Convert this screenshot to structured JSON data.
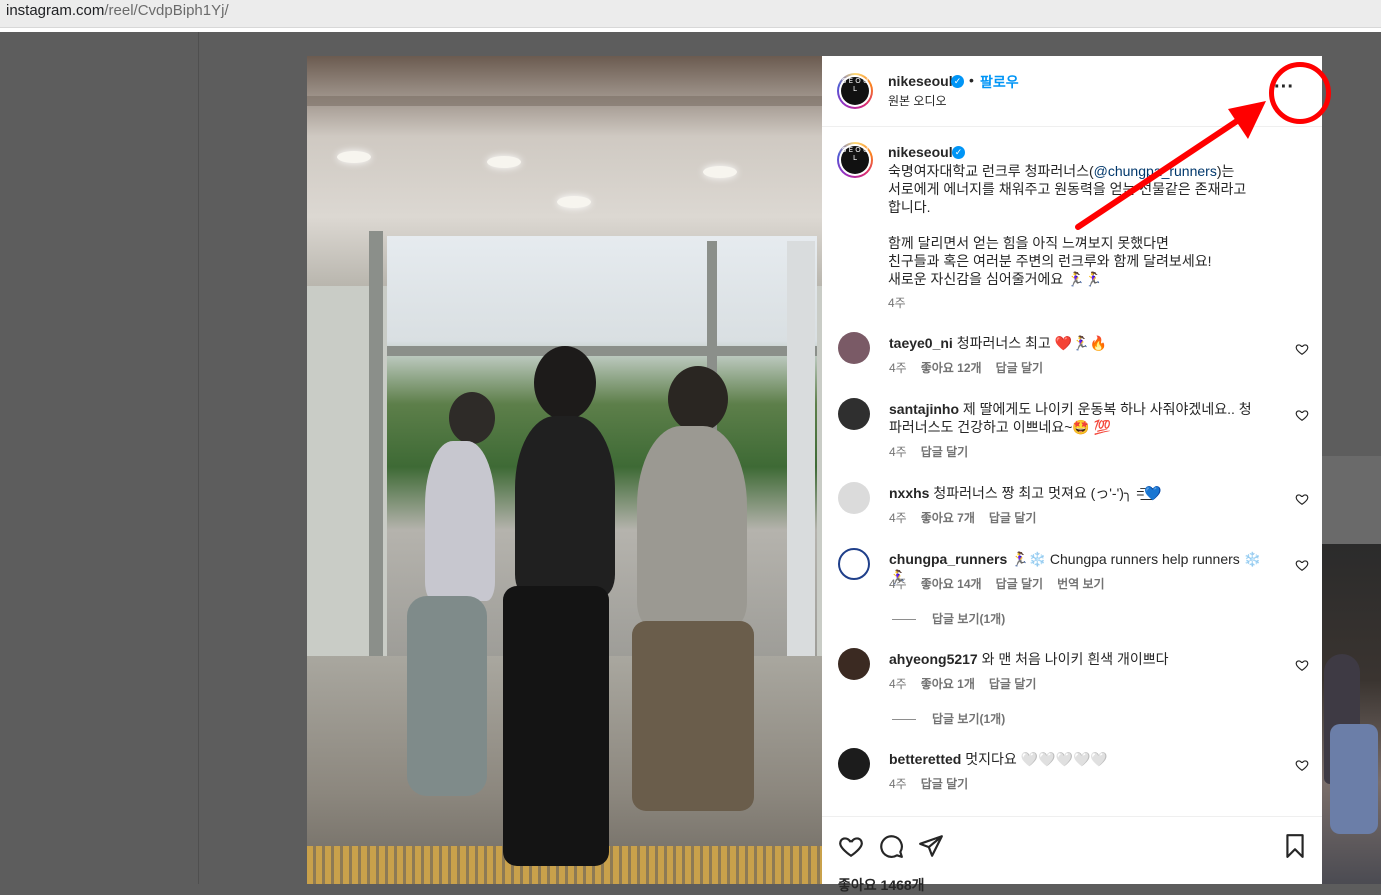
{
  "browser": {
    "url_domain": "instagram.com",
    "url_path": "/reel/CvdpBiph1Yj/"
  },
  "post": {
    "author": "nikeseoul",
    "follow_label": "팔로우",
    "audio_label": "원본 오디오",
    "avatar_text": "S E O U L",
    "more_label": "···",
    "caption_before_mention": "숙명여자대학교 런크루 청파러너스(",
    "caption_mention": "@chungpa_runners",
    "caption_after_mention": ")는\n서로에게 에너지를 채워주고 원동력을 얻는 선물같은 존재라고\n합니다.\n\n함께 달리면서 얻는 힘을 아직 느껴보지 못했다면\n친구들과 혹은 여러분 주변의 런크루와 함께 달려보세요!\n새로운 자신감을 심어줄거에요 🏃‍♀️🏃‍♀️",
    "caption_time": "4주",
    "likes_label": "좋아요 1468개"
  },
  "comments": [
    {
      "user": "taeye0_ni",
      "text": "청파러너스 최고 ❤️🏃‍♀️🔥",
      "time": "4주",
      "likes": "좋아요 12개",
      "reply": "답글 달기",
      "avatar_color": "#7a5a66"
    },
    {
      "user": "santajinho",
      "text": "제 딸에게도 나이키 운동복 하나 사줘야겠네요.. 청파러너스도 건강하고 이쁘네요~🤩 💯",
      "time": "4주",
      "likes": "",
      "reply": "답글 달기",
      "avatar_color": "#2f2f2f"
    },
    {
      "user": "nxxhs",
      "text": "청파러너스 짱 최고 멋져요 (っ'-')╮ =͟͟͞💙",
      "time": "4주",
      "likes": "좋아요 7개",
      "reply": "답글 달기",
      "avatar_color": "#dbdbdb"
    },
    {
      "user": "chungpa_runners",
      "text": "🏃‍♀️❄️ Chungpa runners help runners ❄️🏃‍♀️",
      "time": "4주",
      "likes": "좋아요 14개",
      "reply": "답글 달기",
      "translate": "번역 보기",
      "view_replies": "답글 보기(1개)",
      "avatar_color": "#1f3f8a"
    },
    {
      "user": "ahyeong5217",
      "text": "와 맨 처음 나이키 흰색 개이쁘다",
      "time": "4주",
      "likes": "좋아요 1개",
      "reply": "답글 달기",
      "view_replies": "답글 보기(1개)",
      "avatar_color": "#3b2a22"
    },
    {
      "user": "betteretted",
      "text": "멋지다요 🤍🤍🤍🤍🤍",
      "time": "4주",
      "likes": "",
      "reply": "답글 달기",
      "avatar_color": "#1c1c1c"
    }
  ],
  "colors": {
    "accent": "#0095f6",
    "annotation": "#ff0000",
    "text": "#262626",
    "muted": "#737373"
  },
  "icons": [
    "verified-badge-icon",
    "more-options-icon",
    "heart-icon",
    "comment-icon",
    "share-icon",
    "bookmark-icon"
  ]
}
